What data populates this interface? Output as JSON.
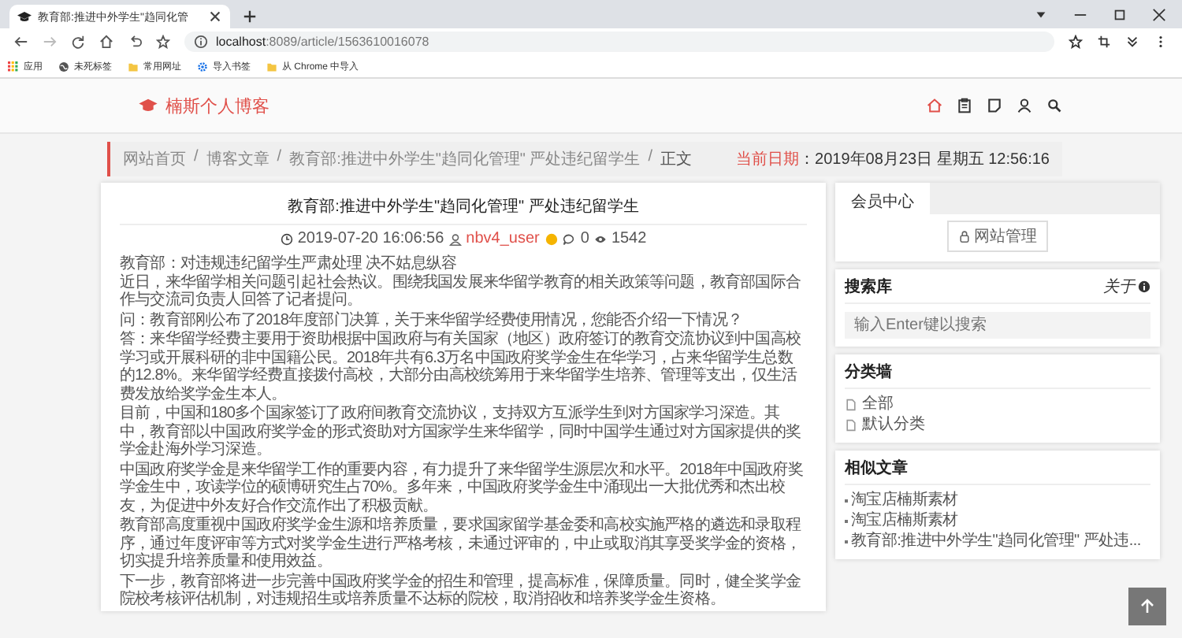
{
  "browser": {
    "tab_title": "教育部:推进中外学生\"趋同化管",
    "url_host": "localhost",
    "url_path": ":8089/article/1563610016078",
    "bookmarks": [
      {
        "kind": "apps",
        "label": "应用"
      },
      {
        "kind": "globe",
        "label": "未死标签"
      },
      {
        "kind": "folder",
        "label": "常用网址"
      },
      {
        "kind": "gear",
        "label": "导入书签"
      },
      {
        "kind": "folder",
        "label": "从 Chrome 中导入"
      }
    ]
  },
  "site": {
    "logo": "楠斯个人博客",
    "nav": [
      {
        "kind": "home",
        "selected": true
      },
      {
        "kind": "clipboard",
        "selected": false
      },
      {
        "kind": "note",
        "selected": false
      },
      {
        "kind": "user",
        "selected": false
      },
      {
        "kind": "search",
        "selected": false
      }
    ]
  },
  "breadcrumb": {
    "separator": "/",
    "items": [
      "网站首页",
      "博客文章",
      "教育部:推进中外学生\"趋同化管理\" 严处违纪留学生",
      "正文"
    ],
    "date_label": "当前日期",
    "date_value": "：2019年08月23日 星期五 12:56:16"
  },
  "article": {
    "title": "教育部:推进中外学生\"趋同化管理\" 严处违纪留学生",
    "date": "2019-07-20 16:06:56",
    "author": "nbv4_user",
    "comments": "0",
    "views": "1542",
    "paragraphs": [
      [
        "教育部：对违规违纪留学生严肃处理 决不姑息纵容",
        "近日，来华留学相关问题引起社会热议。围绕我国发展来华留学教育的相关政策等问题，教育部国际合作与交流司负责人回答了记者提问。"
      ],
      [
        "问：教育部刚公布了2018年度部门决算，关于来华留学经费使用情况，您能否介绍一下情况？"
      ],
      [
        "答：来华留学经费主要用于资助根据中国政府与有关国家（地区）政府签订的教育交流协议到中国高校学习或开展科研的非中国籍公民。2018年共有6.3万名中国政府奖学金生在华学习，占来华留学生总数的12.8%。来华留学经费直接拨付高校，大部分由高校统筹用于来华留学生培养、管理等支出，仅生活费发放给奖学金生本人。"
      ],
      [
        "目前，中国和180多个国家签订了政府间教育交流协议，支持双方互派学生到对方国家学习深造。其中，教育部以中国政府奖学金的形式资助对方国家学生来华留学，同时中国学生通过对方国家提供的奖学金赴海外学习深造。"
      ],
      [
        "中国政府奖学金是来华留学工作的重要内容，有力提升了来华留学生源层次和水平。2018年中国政府奖学金生中，攻读学位的硕博研究生占70%。多年来，中国政府奖学金生中涌现出一大批优秀和杰出校友，为促进中外友好合作交流作出了积极贡献。"
      ],
      [
        "教育部高度重视中国政府奖学金生源和培养质量，要求国家留学基金委和高校实施严格的遴选和录取程序，通过年度评审等方式对奖学金生进行严格考核，未通过评审的，中止或取消其享受奖学金的资格，切实提升培养质量和使用效益。"
      ],
      [
        "下一步，教育部将进一步完善中国政府奖学金的招生和管理，提高标准，保障质量。同时，健全奖学金院校考核评估机制，对违规招生或培养质量不达标的院校，取消招收和培养奖学金生资格。"
      ]
    ]
  },
  "sidebar": {
    "member": {
      "tab": "会员中心",
      "button": "网站管理"
    },
    "search": {
      "title": "搜索库",
      "about": "关于",
      "placeholder": "输入Enter键以搜索"
    },
    "categories": {
      "title": "分类墙",
      "items": [
        "全部",
        "默认分类"
      ]
    },
    "related": {
      "title": "相似文章",
      "items": [
        "淘宝店楠斯素材",
        "淘宝店楠斯素材",
        "教育部:推进中外学生\"趋同化管理\" 严处违..."
      ]
    }
  }
}
